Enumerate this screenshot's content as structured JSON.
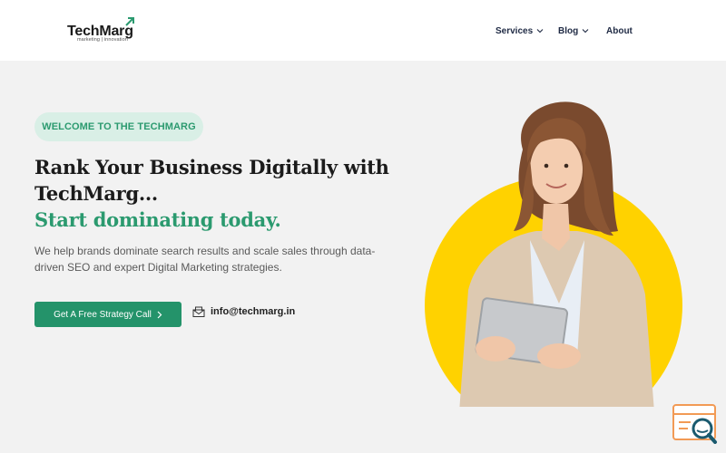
{
  "brand": {
    "name": "TechMarg",
    "tagline": "marketing | innovation"
  },
  "nav": [
    {
      "label": "Services"
    },
    {
      "label": "Blog"
    },
    {
      "label": "About"
    }
  ],
  "hero": {
    "badge": "WELCOME TO THE TECHMARG",
    "headline_line1": "Rank Your Business Digitally with",
    "headline_line2": "TechMarg...",
    "headline_accent": "Start dominating today.",
    "lead": "We help brands dominate search results and scale sales through data-driven SEO and expert Digital Marketing strategies.",
    "cta_label": "Get A Free Strategy Call",
    "email": "info@techmarg.in"
  },
  "colors": {
    "accent": "#24936a",
    "badge_bg": "#d9efe6",
    "circle": "#ffd200",
    "page_bg": "#f2f2f2"
  },
  "icons": [
    "chevron-down-icon",
    "chevron-right-icon",
    "mail-icon",
    "logo-arrow-icon",
    "chat-search-icon"
  ]
}
